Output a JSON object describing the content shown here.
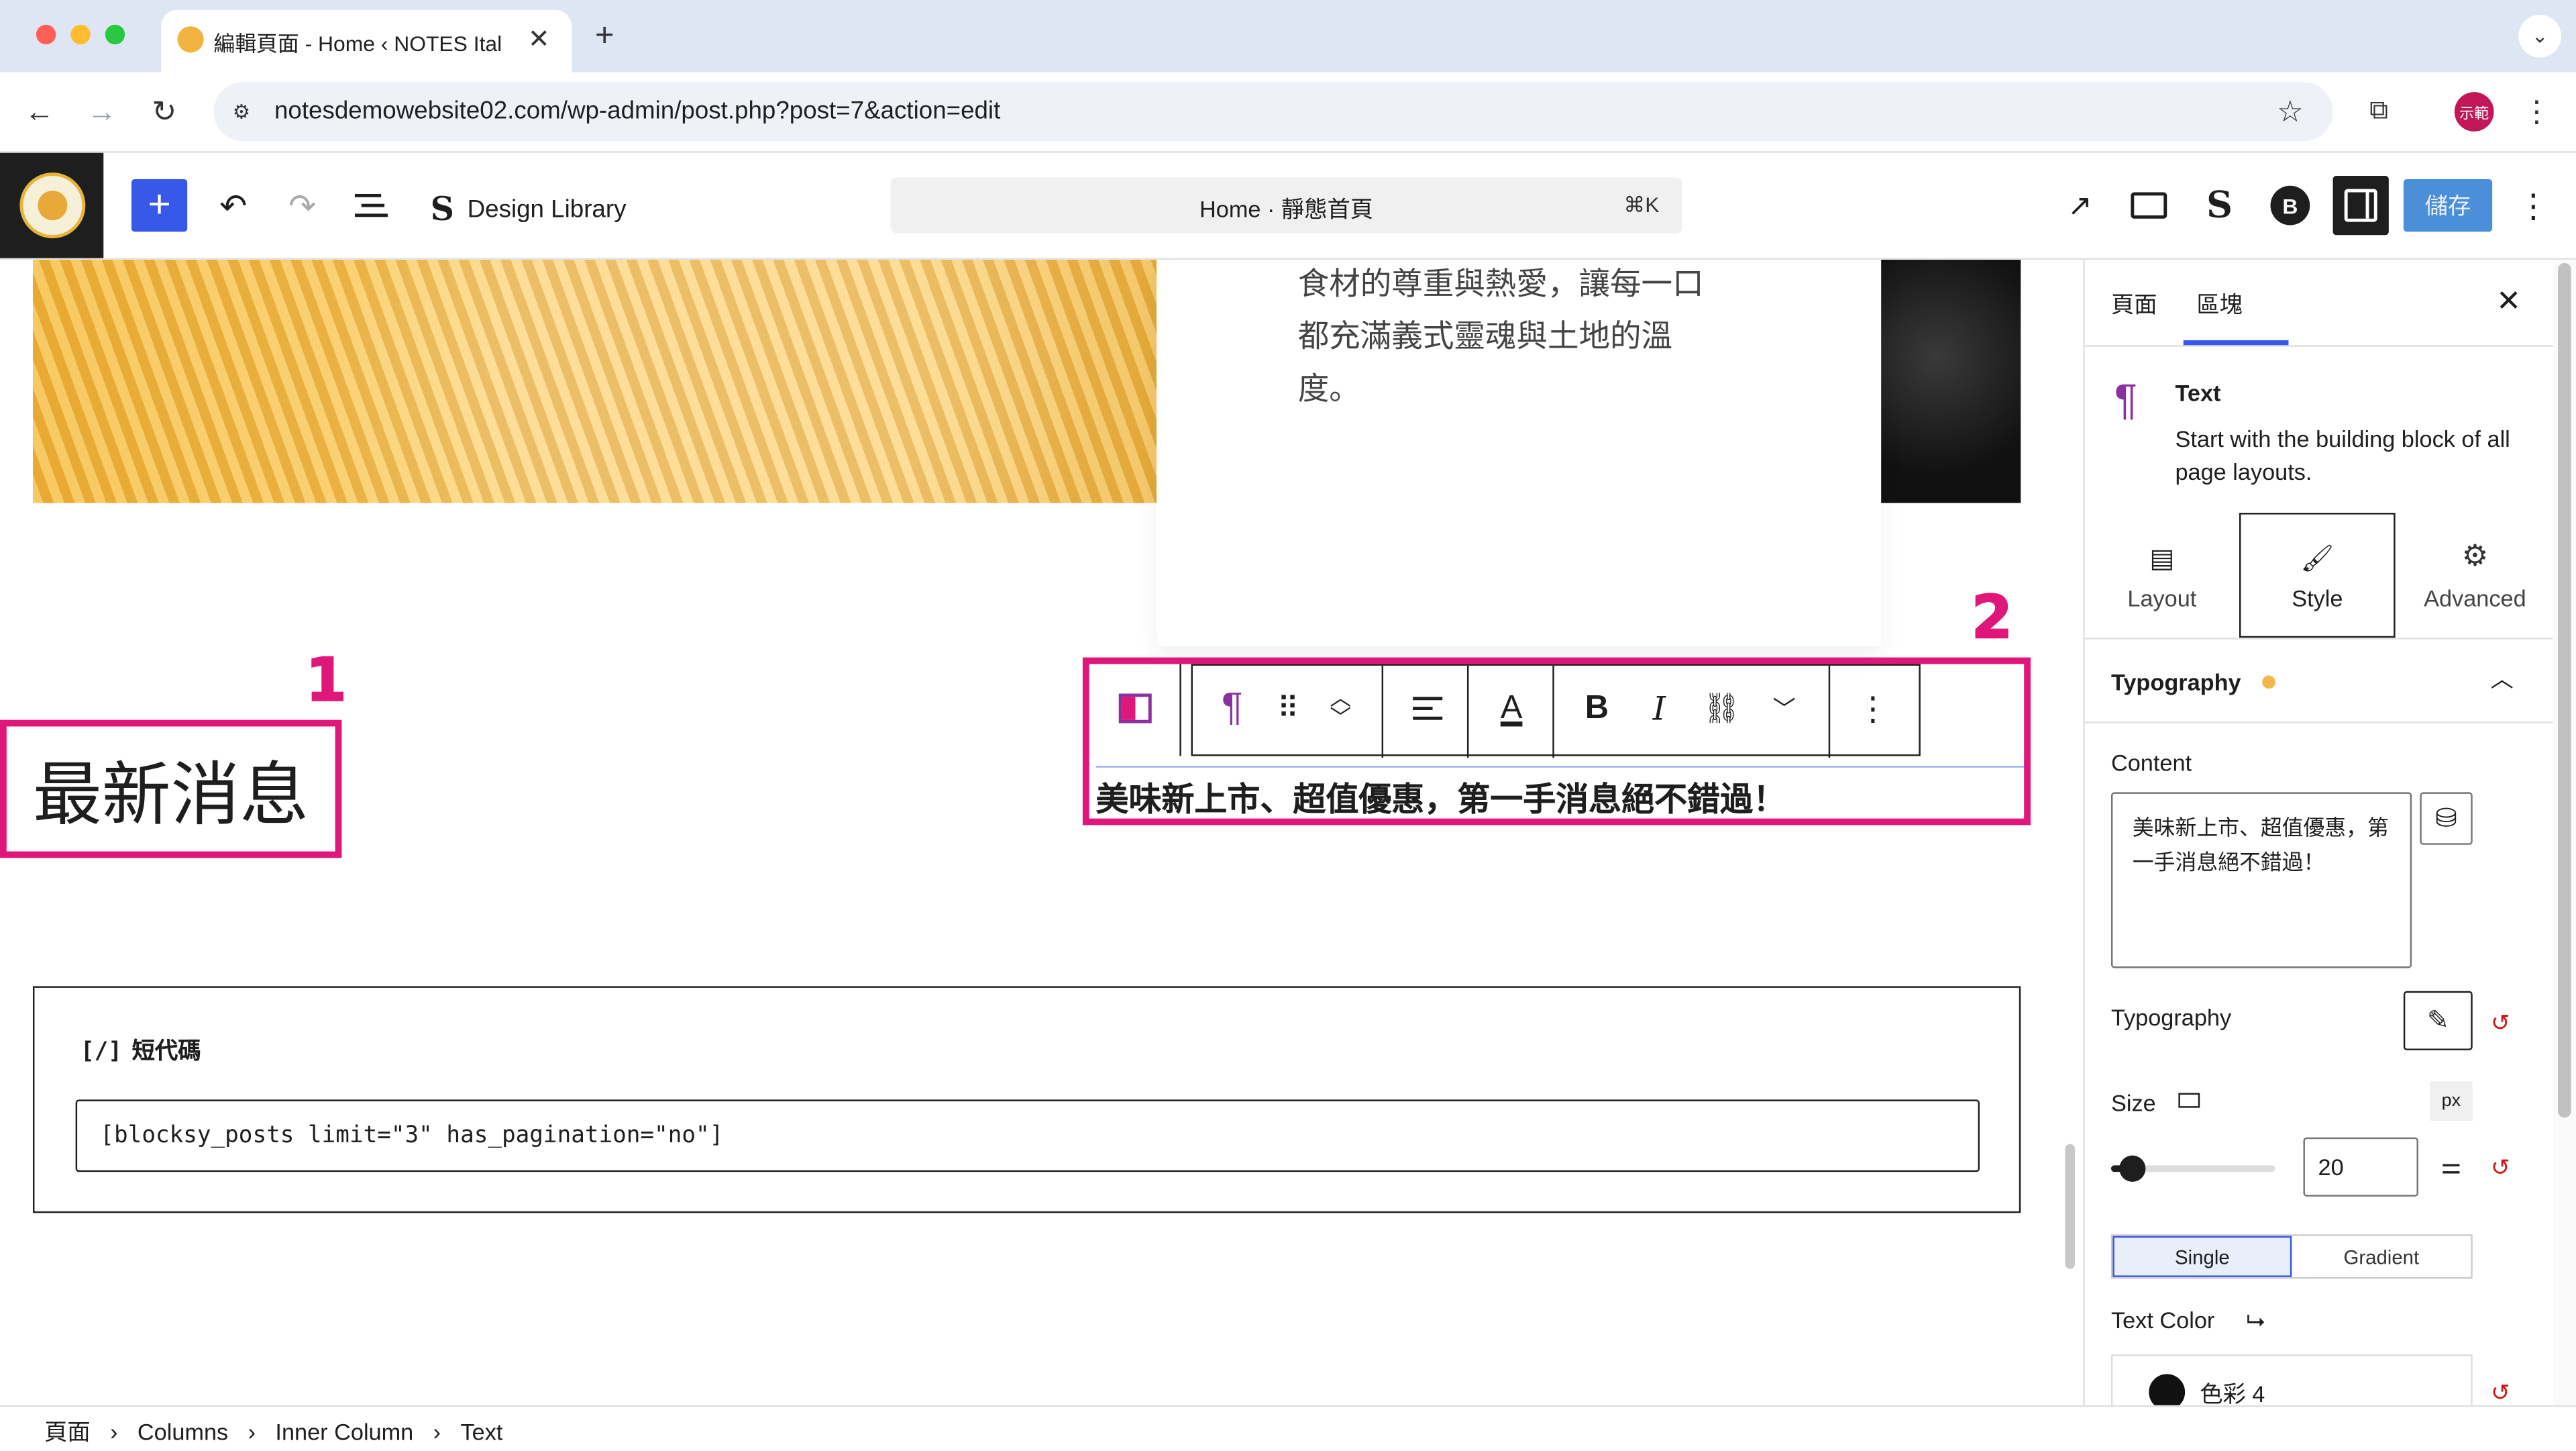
{
  "browser": {
    "tab_title": "編輯頁面 - Home ‹ NOTES Ital",
    "url": "notesdemowebsite02.com/wp-admin/post.php?post=7&action=edit",
    "profile_label": "示範"
  },
  "toolbar": {
    "design_library_label": "Design Library",
    "command_title": "Home · 靜態首頁",
    "command_shortcut": "⌘K",
    "save_label": "儲存",
    "blocksy_letter": "B"
  },
  "canvas": {
    "intro_text": "食材的尊重與熱愛，讓每一口都充滿義式靈魂與土地的溫度。",
    "heading": "最新消息",
    "annotation_1": "1",
    "annotation_2": "2",
    "paragraph_text": "美味新上市、超值優惠，第一手消息絕不錯過！",
    "shortcode_label": "短代碼",
    "shortcode_icon_text": "[/]",
    "shortcode_value": "[blocksy_posts limit=\"3\" has_pagination=\"no\"]"
  },
  "block_toolbar": {
    "bold_label": "B",
    "italic_label": "I"
  },
  "sidebar": {
    "tabs": [
      "頁面",
      "區塊"
    ],
    "active_tab": "區塊",
    "block_name": "Text",
    "block_description": "Start with the building block of all page layouts.",
    "subtabs": [
      {
        "label": "Layout",
        "icon": "layout-icon"
      },
      {
        "label": "Style",
        "icon": "brush-icon"
      },
      {
        "label": "Advanced",
        "icon": "gear-icon"
      }
    ],
    "active_subtab": "Style",
    "section_title": "Typography",
    "content_label": "Content",
    "content_value": "美味新上市、超值優惠，第一手消息絕不錯過！",
    "typography_label": "Typography",
    "size_label": "Size",
    "size_unit": "px",
    "size_value": "20",
    "color_modes": [
      "Single",
      "Gradient"
    ],
    "active_color_mode": "Single",
    "text_color_label": "Text Color",
    "color_name": "色彩 4",
    "accent_dot": "#f0b849"
  },
  "breadcrumb": [
    "頁面",
    "Columns",
    "Inner Column",
    "Text"
  ],
  "colors": {
    "wp_blue": "#3858e9",
    "save_blue": "#4a8fd8",
    "annotation_pink": "#e0177a"
  }
}
